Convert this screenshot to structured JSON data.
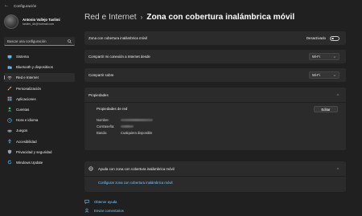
{
  "window": {
    "title": "Configuración"
  },
  "profile": {
    "name": "Antonio Vallejo Taslimi",
    "email": "taslimi_db@hotmail.com"
  },
  "search": {
    "placeholder": "Buscar una configuración"
  },
  "sidebar": {
    "items": [
      {
        "label": "Sistema",
        "icon": "monitor-icon",
        "color": "#4cc2ff"
      },
      {
        "label": "Bluetooth y dispositivos",
        "icon": "bluetooth-icon",
        "color": "#4cc2ff"
      },
      {
        "label": "Red e Internet",
        "icon": "network-icon",
        "color": "#cfcfcf",
        "active": true
      },
      {
        "label": "Personalización",
        "icon": "brush-icon",
        "color": "#e8a56b"
      },
      {
        "label": "Aplicaciones",
        "icon": "apps-icon",
        "color": "#9aa3ad"
      },
      {
        "label": "Cuentas",
        "icon": "person-icon",
        "color": "#3fbf7f"
      },
      {
        "label": "Hora e idioma",
        "icon": "globe-clock-icon",
        "color": "#4cc2ff"
      },
      {
        "label": "Juegos",
        "icon": "gamepad-icon",
        "color": "#9aa3ad"
      },
      {
        "label": "Accesibilidad",
        "icon": "accessibility-icon",
        "color": "#4cc2ff"
      },
      {
        "label": "Privacidad y seguridad",
        "icon": "shield-icon",
        "color": "#9aa3ad"
      },
      {
        "label": "Windows Update",
        "icon": "update-icon",
        "color": "#4cc2ff"
      }
    ]
  },
  "breadcrumb": {
    "parent": "Red e Internet",
    "separator": "›",
    "current": "Zona con cobertura inalámbrica móvil"
  },
  "hotspot": {
    "label": "Zona con cobertura inalámbrica móvil",
    "state": "Desactivado",
    "on": false
  },
  "share_from": {
    "label": "Compartir mi conexión a Internet desde",
    "value": "Wi-Fi"
  },
  "share_over": {
    "label": "Compartir sobre",
    "value": "Wi-Fi"
  },
  "properties": {
    "section_label": "Propiedades",
    "title": "Propiedades de red",
    "edit_label": "Editar",
    "name_label": "Nombre:",
    "password_label": "Contraseña:",
    "band_label": "Banda:",
    "band_value": "Cualquiera disponible"
  },
  "help": {
    "label": "Ayuda con zona con cobertura inalámbrica móvil",
    "link": "Configurar zona con cobertura inalámbrica móvil"
  },
  "footer": {
    "get_help": "Obtener ayuda",
    "feedback": "Enviar comentarios"
  },
  "colors": {
    "accent": "#4cc2ff",
    "link": "#7ec8ff",
    "background": "#202020",
    "card": "#2b2b2b"
  }
}
